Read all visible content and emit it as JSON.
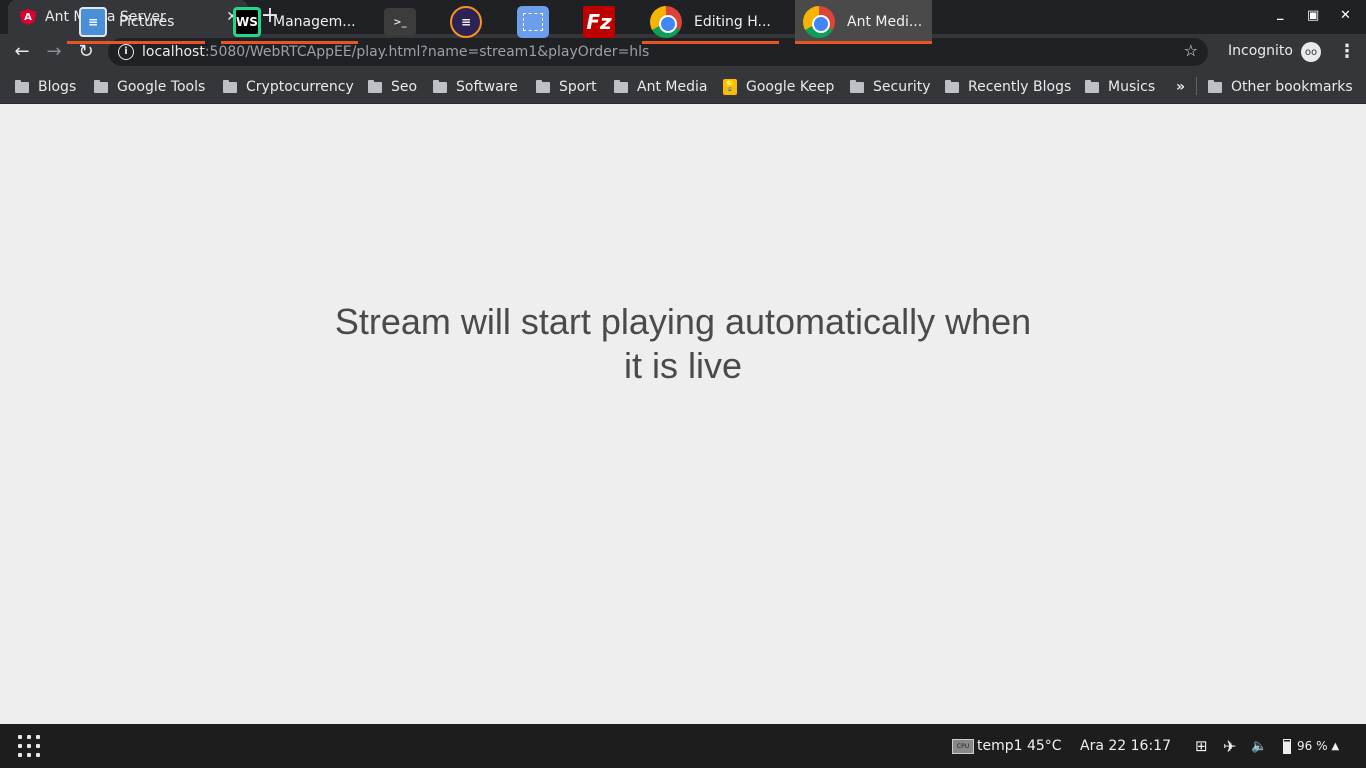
{
  "browser": {
    "tab": {
      "title": "Ant Media Server",
      "favicon": "angular-icon",
      "close": "✕"
    },
    "new_tab": "+",
    "window_controls": {
      "minimize": "_",
      "maximize": "▣",
      "close": "✕"
    },
    "nav": {
      "back": "←",
      "forward": "→",
      "reload": "↻"
    },
    "url": {
      "host": "localhost",
      "rest": ":5080/WebRTCAppEE/play.html?name=stream1&playOrder=hls"
    },
    "star": "☆",
    "incognito_label": "Incognito",
    "menu": "⋮",
    "bookmarks": [
      {
        "label": "Blogs",
        "icon": "folder-icon"
      },
      {
        "label": "Google Tools",
        "icon": "folder-icon"
      },
      {
        "label": "Cryptocurrency",
        "icon": "folder-icon"
      },
      {
        "label": "Seo",
        "icon": "folder-icon"
      },
      {
        "label": "Software",
        "icon": "folder-icon"
      },
      {
        "label": "Sport",
        "icon": "folder-icon"
      },
      {
        "label": "Ant Media",
        "icon": "folder-icon"
      },
      {
        "label": "Google Keep",
        "icon": "google-keep-icon"
      },
      {
        "label": "Security",
        "icon": "folder-icon"
      },
      {
        "label": "Recently Blogs",
        "icon": "folder-icon"
      },
      {
        "label": "Musics",
        "icon": "folder-icon"
      }
    ],
    "bookmarks_overflow": "»",
    "other_bookmarks": "Other bookmarks"
  },
  "page": {
    "message": "Stream will start playing automatically when it is live"
  },
  "taskbar": {
    "apps": [
      {
        "label": "Pictures",
        "icon": "file-manager-icon"
      },
      {
        "label": "Managem...",
        "icon": "webstorm-icon"
      },
      {
        "label": "",
        "icon": "terminal-icon"
      },
      {
        "label": "",
        "icon": "eclipse-icon"
      },
      {
        "label": "",
        "icon": "screenshot-icon"
      },
      {
        "label": "",
        "icon": "filezilla-icon"
      },
      {
        "label": "Editing H...",
        "icon": "chrome-icon"
      },
      {
        "label": "Ant Medi...",
        "icon": "chrome-icon"
      }
    ],
    "temp": "temp1 45°C",
    "datetime": "Ara 22  16:17",
    "battery": "96 %",
    "accent": "#e95420"
  }
}
